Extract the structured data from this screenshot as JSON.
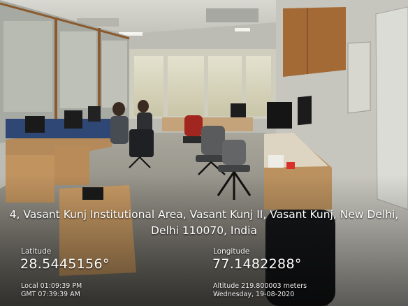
{
  "overlay": {
    "address_line1": "4, Vasant Kunj Institutional Area, Vasant Kunj II, Vasant Kunj, New Delhi,",
    "address_line2": "Delhi 110070, India",
    "latitude_label": "Latitude",
    "latitude_value": "28.5445156°",
    "longitude_label": "Longitude",
    "longitude_value": "77.1482288°",
    "local_time": "Local 01:09:39 PM",
    "gmt_time": "GMT 07:39:39 AM",
    "altitude": "Altitude 219.800003 meters",
    "date": "Wednesday, 19-08-2020"
  }
}
